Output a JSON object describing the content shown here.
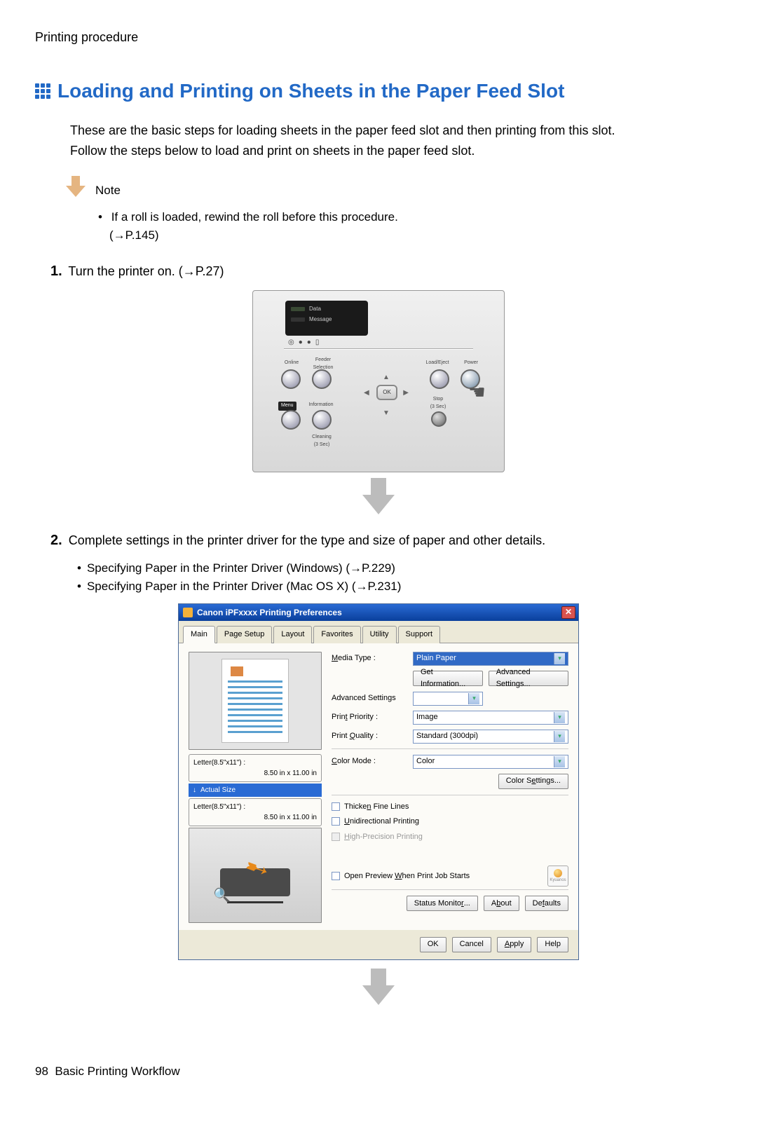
{
  "breadcrumb": "Printing procedure",
  "heading": "Loading and Printing on Sheets in the Paper Feed Slot",
  "intro_line1": "These are the basic steps for loading sheets in the paper feed slot and then printing from this slot.",
  "intro_line2": "Follow the steps below to load and print on sheets in the paper feed slot.",
  "note_label": "Note",
  "note_bullet": "If a roll is loaded, rewind the roll before this procedure.",
  "note_ref": "(→P.145)",
  "step1_num": "1.",
  "step1_text": "Turn the printer on.  (→P.27)",
  "panel": {
    "lcd_data": "Data",
    "lcd_msg": "Message",
    "online": "Online",
    "feeder": "Feeder\nSelection",
    "loadeject": "Load/Eject",
    "power": "Power",
    "menu": "Menu",
    "info": "Information",
    "stop": "Stop\n(3 Sec)",
    "cleaning": "Cleaning\n(3 Sec)",
    "ok": "OK"
  },
  "step2_num": "2.",
  "step2_text": "Complete settings in the printer driver for the type and size of paper and other details.",
  "step2_b1": "Specifying Paper in the Printer Driver (Windows) (→P.229)",
  "step2_b2": "Specifying Paper in the Printer Driver (Mac OS X) (→P.231)",
  "dialog": {
    "title": "Canon iPFxxxx Printing Preferences",
    "tabs": [
      "Main",
      "Page Setup",
      "Layout",
      "Favorites",
      "Utility",
      "Support"
    ],
    "media_type_label": "Media Type :",
    "media_type_value": "Plain Paper",
    "get_info": "Get Information...",
    "adv_settings_btn": "Advanced Settings...",
    "adv_settings_label": "Advanced Settings",
    "print_priority_label": "Print Priority :",
    "print_priority_value": "Image",
    "print_quality_label": "Print Quality :",
    "print_quality_value": "Standard (300dpi)",
    "color_mode_label": "Color Mode :",
    "color_mode_value": "Color",
    "color_settings": "Color Settings...",
    "thicken": "Thicken Fine Lines",
    "unidir": "Unidirectional Printing",
    "highprec": "High-Precision Printing",
    "preview_chk": "Open Preview When Print Job Starts",
    "kyuanos": "Kyuanos",
    "status_monitor": "Status Monitor...",
    "about": "About",
    "defaults": "Defaults",
    "ok": "OK",
    "cancel": "Cancel",
    "apply": "Apply",
    "help": "Help",
    "letter_label": "Letter(8.5\"x11\") :",
    "letter_dim": "8.50 in x 11.00 in",
    "actual_size": "Actual Size"
  },
  "footer_num": "98",
  "footer_text": "Basic Printing Workflow"
}
